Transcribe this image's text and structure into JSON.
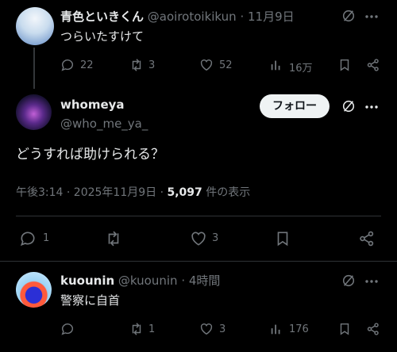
{
  "post1": {
    "display_name": "青色といきくん",
    "handle": "@aoirotoikikun",
    "sep": "·",
    "date": "11月9日",
    "text": "つらいたすけて",
    "metrics": {
      "replies": "22",
      "reposts": "3",
      "likes": "52",
      "views": "16万"
    }
  },
  "main": {
    "display_name": "whomeya",
    "handle": "@who_me_ya_",
    "follow_label": "フォロー",
    "text": "どうすれば助けられる？",
    "time": "午後3:14 · 2025年11月9日 ·",
    "views_count": "5,097",
    "views_suffix": "件の表示",
    "metrics": {
      "replies": "1",
      "likes": "3"
    }
  },
  "reply": {
    "display_name": "kuounin",
    "handle": "@kuounin",
    "sep": "·",
    "time": "4時間",
    "text": "警察に自首",
    "metrics": {
      "reposts": "1",
      "likes": "3",
      "views": "176"
    }
  },
  "colors": {
    "bg": "#000000",
    "text": "#e7e9ea",
    "muted": "#71767b",
    "border": "#2f3336"
  }
}
